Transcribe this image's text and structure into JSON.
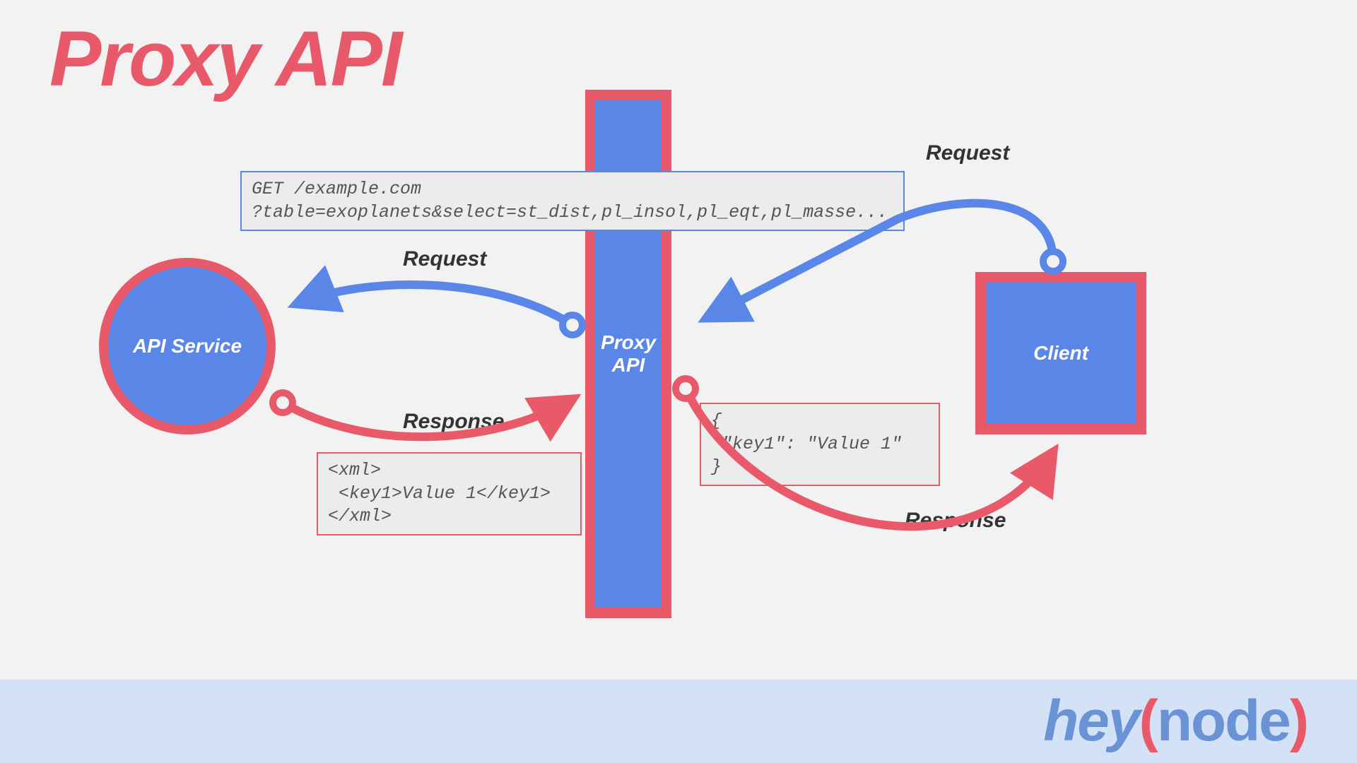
{
  "title": "Proxy API",
  "nodes": {
    "api_service": "API Service",
    "proxy": "Proxy\nAPI",
    "client": "Client"
  },
  "labels": {
    "request_left": "Request",
    "response_left": "Response",
    "request_right": "Request",
    "response_right": "Response"
  },
  "code": {
    "http_request": "GET /example.com\n?table=exoplanets&select=st_dist,pl_insol,pl_eqt,pl_masse...",
    "xml_response": "<xml>\n <key1>Value 1</key1>\n</xml>",
    "json_response": "{\n \"key1\": \"Value 1\"\n}"
  },
  "footer": {
    "hey": "hey",
    "open": "(",
    "node": "node",
    "close": ")"
  },
  "colors": {
    "red": "#e85a6a",
    "blue": "#5a86e8",
    "bg": "#f2f2f2",
    "footer_bg": "#d4e2f7"
  }
}
